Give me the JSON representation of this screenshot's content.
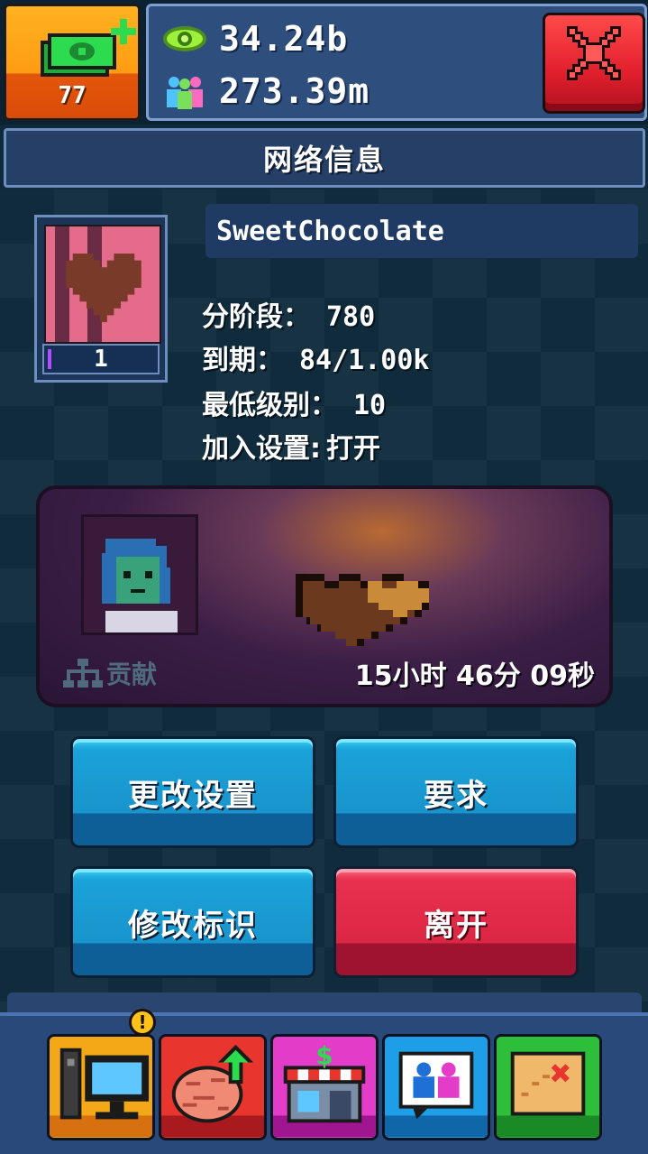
{
  "header": {
    "cash_count": "77",
    "views": "34.24b",
    "followers": "273.39m"
  },
  "title": "网络信息",
  "network": {
    "name": "SweetChocolate",
    "level": "1",
    "info": [
      {
        "label": "分阶段：",
        "value": "780"
      },
      {
        "label": "到期：",
        "value": "84/1.00k"
      },
      {
        "label": "最低级别：",
        "value": "10"
      },
      {
        "label": "加入设置:",
        "value": "打开"
      }
    ]
  },
  "contribution": {
    "label": "贡献",
    "timer": "15小时 46分 09秒"
  },
  "buttons": {
    "change_settings": "更改设置",
    "requirements": "要求",
    "edit_logo": "修改标识",
    "leave": "离开"
  },
  "nav": {
    "alert": "!",
    "items": [
      "computer-icon",
      "brain-upgrade-icon",
      "shop-icon",
      "social-icon",
      "map-icon"
    ]
  },
  "colors": {
    "accent_blue": "#1994cc",
    "danger_red": "#db2644",
    "cash_orange": "#ff9c12"
  }
}
